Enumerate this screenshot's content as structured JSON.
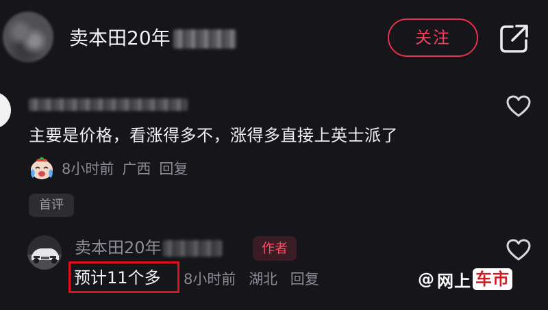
{
  "header": {
    "username": "卖本田20年",
    "follow_label": "关注"
  },
  "comment": {
    "text": "主要是价格，看涨得多不，涨得多直接上英士派了",
    "time": "8小时前",
    "location": "广西",
    "reply_label": "回复",
    "badge": "首评"
  },
  "reply": {
    "username": "卖本田20年",
    "author_badge": "作者",
    "text": "预计11个多",
    "time": "8小时前",
    "location": "湖北",
    "reply_label": "回复"
  },
  "watermark": {
    "prefix": "@",
    "part1": "网上",
    "part2": "车市"
  },
  "colors": {
    "background": "#16161a",
    "accent": "#ff3c5c",
    "highlight_box": "#e0101e",
    "muted_text": "#8a8a92"
  },
  "icons": [
    "share-icon",
    "heart-icon",
    "crying-face-emoji"
  ]
}
